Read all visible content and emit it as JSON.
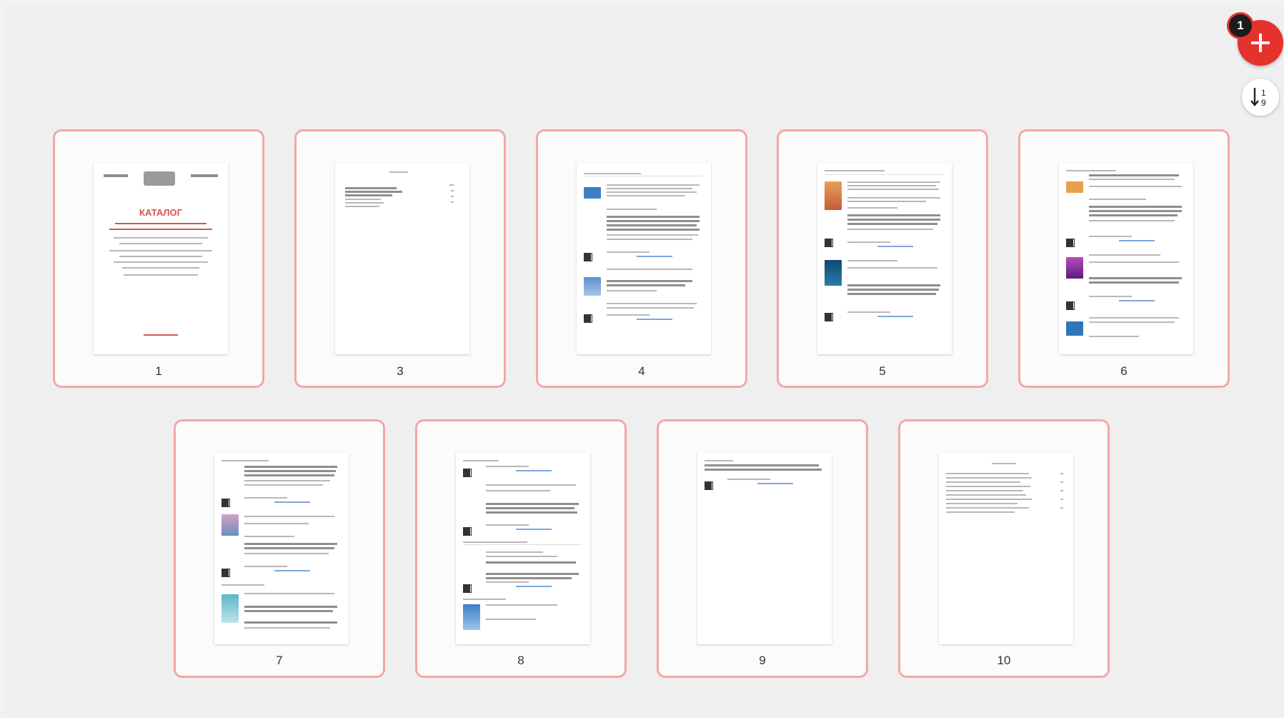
{
  "toolbar": {
    "add_badge": "1",
    "add_icon": "plus-icon",
    "sort_icon": "sort-numeric-icon"
  },
  "colors": {
    "accent": "#e5322d",
    "card_border": "#f3a7a7",
    "badge": "#1c1c1c"
  },
  "pages": [
    {
      "label": "1"
    },
    {
      "label": "3"
    },
    {
      "label": "4"
    },
    {
      "label": "5"
    },
    {
      "label": "6"
    },
    {
      "label": "7"
    },
    {
      "label": "8"
    },
    {
      "label": "9"
    },
    {
      "label": "10"
    }
  ],
  "cover": {
    "title": "КАТАЛОГ"
  }
}
